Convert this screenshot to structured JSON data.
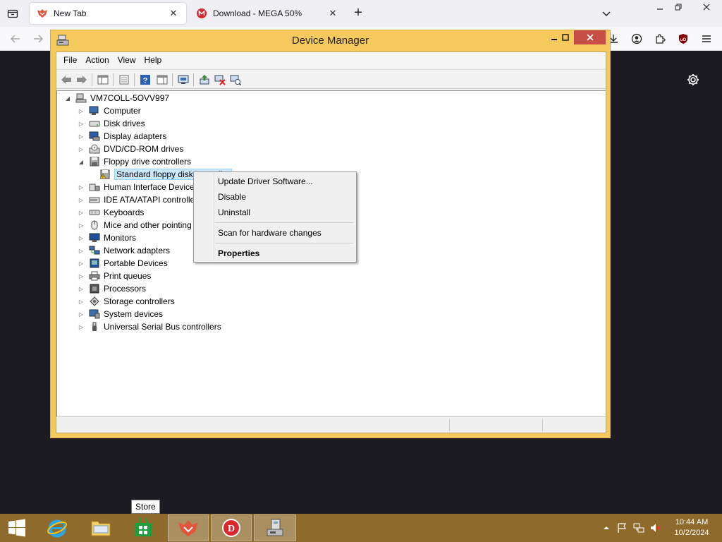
{
  "browser": {
    "tabs": [
      {
        "title": "New Tab",
        "active": true
      },
      {
        "title": "Download - MEGA 50%",
        "active": false
      }
    ],
    "new_tab_symbol": "+",
    "close_symbol": "✕"
  },
  "device_manager": {
    "title": "Device Manager",
    "menu": [
      "File",
      "Action",
      "View",
      "Help"
    ],
    "root": "VM7COLL-5OVV997",
    "categories": [
      {
        "label": "Computer",
        "icon": "computer-icon"
      },
      {
        "label": "Disk drives",
        "icon": "disk-drive-icon"
      },
      {
        "label": "Display adapters",
        "icon": "display-adapter-icon"
      },
      {
        "label": "DVD/CD-ROM drives",
        "icon": "dvd-drive-icon"
      },
      {
        "label": "Floppy drive controllers",
        "icon": "floppy-controller-icon",
        "expanded": true
      },
      {
        "label": "Standard floppy disk controller",
        "icon": "floppy-warning-icon",
        "child": true,
        "selected": true
      },
      {
        "label": "Human Interface Devices",
        "icon": "hid-icon"
      },
      {
        "label": "IDE ATA/ATAPI controllers",
        "icon": "ide-icon"
      },
      {
        "label": "Keyboards",
        "icon": "keyboard-icon"
      },
      {
        "label": "Mice and other pointing devices",
        "icon": "mouse-icon"
      },
      {
        "label": "Monitors",
        "icon": "monitor-icon"
      },
      {
        "label": "Network adapters",
        "icon": "network-icon"
      },
      {
        "label": "Portable Devices",
        "icon": "portable-device-icon"
      },
      {
        "label": "Print queues",
        "icon": "printer-icon"
      },
      {
        "label": "Processors",
        "icon": "processor-icon"
      },
      {
        "label": "Storage controllers",
        "icon": "storage-icon"
      },
      {
        "label": "System devices",
        "icon": "system-device-icon"
      },
      {
        "label": "Universal Serial Bus controllers",
        "icon": "usb-icon"
      }
    ]
  },
  "context_menu": {
    "update": "Update Driver Software...",
    "disable": "Disable",
    "uninstall": "Uninstall",
    "scan": "Scan for hardware changes",
    "properties": "Properties"
  },
  "taskbar": {
    "tooltip": "Store",
    "time": "10:44 AM",
    "date": "10/2/2024"
  },
  "colors": {
    "window_frame": "#f5c95b",
    "taskbar": "#8e6a2c",
    "close_button": "#c74e44",
    "selection": "#cce8ff"
  }
}
